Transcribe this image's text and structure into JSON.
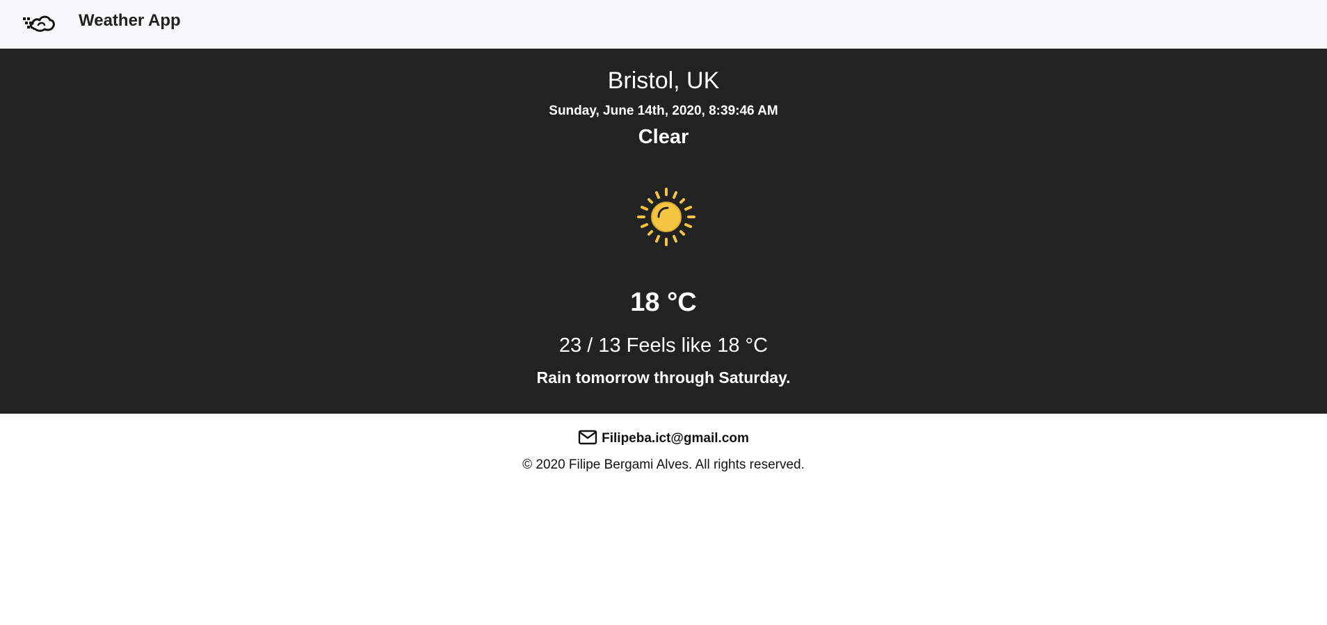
{
  "navbar": {
    "logo_icon": "cloud-wind-icon",
    "title": "Weather App"
  },
  "weather": {
    "location": "Bristol, UK",
    "datetime": "Sunday, June 14th, 2020, 8:39:46 AM",
    "condition": "Clear",
    "icon": "sun-icon",
    "icon_color": "#f5c542",
    "temperature": "18 °C",
    "minmax_feels": "23 / 13 Feels like 18 °C",
    "summary": "Rain tomorrow through Saturday."
  },
  "footer": {
    "mail_icon": "mail-icon",
    "email": "Filipeba.ict@gmail.com",
    "copyright": "© 2020 Filipe Bergami Alves. All rights reserved."
  },
  "colors": {
    "navbar_bg": "#f8f9fa",
    "panel_bg": "#222222",
    "panel_text": "#ffffff",
    "footer_bg": "#ffffff"
  }
}
